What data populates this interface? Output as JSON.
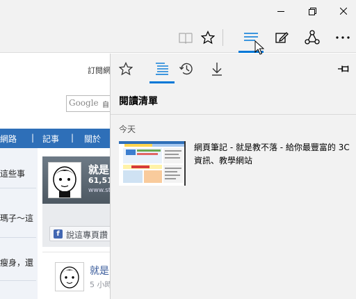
{
  "window": {
    "controls": [
      "minimize-icon",
      "restore-icon",
      "close-icon"
    ]
  },
  "toolbar": {
    "buttons": [
      "reading-view-icon",
      "favorites-star-icon",
      "hub-icon",
      "web-note-icon",
      "share-icon",
      "more-icon"
    ],
    "active": "hub-icon",
    "accent": "#0078d7"
  },
  "page": {
    "subscribe_text": "訂閱網",
    "google_logo": "Google",
    "google_suffix": "自",
    "nav_items": [
      "網路",
      "|",
      "記事",
      "|",
      "關於"
    ],
    "sidebar_posts": [
      "這些事",
      "瑪子～這",
      "瘦身，還"
    ],
    "fb": {
      "page_name": "就是",
      "count": "61,51",
      "url": "www.stc",
      "like_label": "說這專頁讚"
    },
    "post": {
      "title": "就是",
      "meta": "5 小時"
    }
  },
  "hub": {
    "tabs": [
      "favorites-star-icon",
      "reading-list-icon",
      "history-icon",
      "downloads-icon"
    ],
    "active_tab": "reading-list-icon",
    "title": "閱讀清單",
    "group_label": "今天",
    "items": [
      {
        "title": "網頁筆記 - 就是教不落 - 給你最豐富的 3C 資訊、教學網站"
      }
    ]
  }
}
